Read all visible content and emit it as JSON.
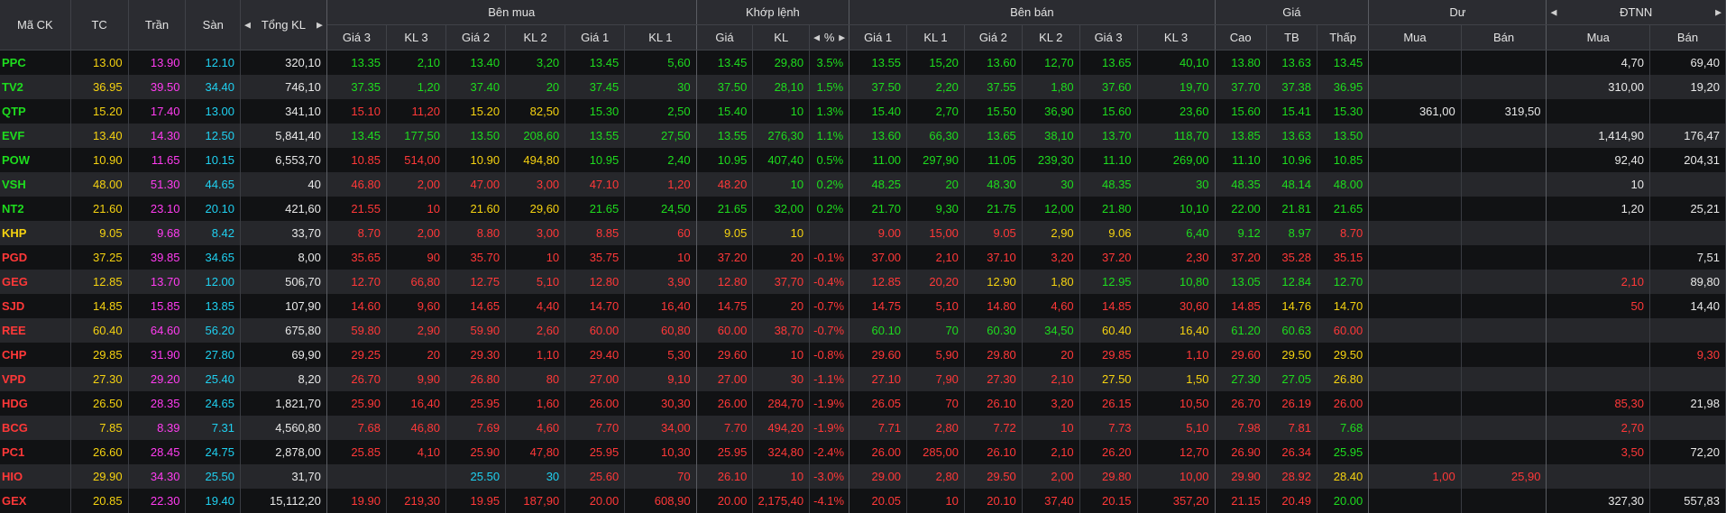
{
  "headers": {
    "top": {
      "symbol": "Mã CK",
      "ref": "TC",
      "ceil": "Trần",
      "floor": "Sàn",
      "total": "Tổng KL",
      "buy": "Bên mua",
      "match": "Khớp lệnh",
      "sell": "Bên bán",
      "price": "Giá",
      "remain": "Dư",
      "foreign": "ĐTNN"
    },
    "sub": {
      "buy": [
        "Giá 3",
        "KL 3",
        "Giá 2",
        "KL 2",
        "Giá 1",
        "KL 1"
      ],
      "match": [
        "Giá",
        "KL",
        "%"
      ],
      "sell": [
        "Giá 1",
        "KL 1",
        "Giá 2",
        "KL 2",
        "Giá 3",
        "KL 3"
      ],
      "price": [
        "Cao",
        "TB",
        "Thấp"
      ],
      "remain": [
        "Mua",
        "Bán"
      ],
      "foreign": [
        "Mua",
        "Bán"
      ]
    }
  },
  "colors": {
    "up": "#1edc1e",
    "down": "#ff3838",
    "ref": "#f5d210",
    "ceiling": "#ff3cf0",
    "floor": "#1fd0f0"
  },
  "rows": [
    {
      "s": "PPC",
      "t": "u",
      "c": [
        "13.00",
        "13.90",
        "12.10",
        "320,10",
        "13.35",
        "2,10",
        "13.40",
        "3,20",
        "13.45",
        "5,60",
        "13.45",
        "29,80",
        "3.5%",
        "13.55",
        "15,20",
        "13.60",
        "12,70",
        "13.65",
        "40,10",
        "13.80",
        "13.63",
        "13.45",
        "",
        "",
        "4,70",
        "69,40"
      ],
      "k": "ycfwuuuuuuuuuuuuuuuuuuwwww"
    },
    {
      "s": "TV2",
      "t": "u",
      "c": [
        "36.95",
        "39.50",
        "34.40",
        "746,10",
        "37.35",
        "1,20",
        "37.40",
        "20",
        "37.45",
        "30",
        "37.50",
        "28,10",
        "1.5%",
        "37.50",
        "2,20",
        "37.55",
        "1,80",
        "37.60",
        "19,70",
        "37.70",
        "37.38",
        "36.95",
        "",
        "",
        "310,00",
        "19,20"
      ],
      "k": "ycfwuuuuuuuuuuuuuuuuuuywwww"
    },
    {
      "s": "QTP",
      "t": "u",
      "c": [
        "15.20",
        "17.40",
        "13.00",
        "341,10",
        "15.10",
        "11,20",
        "15.20",
        "82,50",
        "15.30",
        "2,50",
        "15.40",
        "10",
        "1.3%",
        "15.40",
        "2,70",
        "15.50",
        "36,90",
        "15.60",
        "23,60",
        "15.60",
        "15.41",
        "15.30",
        "361,00",
        "319,50",
        "",
        ""
      ],
      "k": "ycfwddyyuuuuuuuuuuuuuuwwww"
    },
    {
      "s": "EVF",
      "t": "u",
      "c": [
        "13.40",
        "14.30",
        "12.50",
        "5,841,40",
        "13.45",
        "177,50",
        "13.50",
        "208,60",
        "13.55",
        "27,50",
        "13.55",
        "276,30",
        "1.1%",
        "13.60",
        "66,30",
        "13.65",
        "38,10",
        "13.70",
        "118,70",
        "13.85",
        "13.63",
        "13.50",
        "",
        "",
        "1,414,90",
        "176,47"
      ],
      "k": "ycfwuuuuuuuuuuuuuuuuuuuwwww"
    },
    {
      "s": "POW",
      "t": "u",
      "c": [
        "10.90",
        "11.65",
        "10.15",
        "6,553,70",
        "10.85",
        "514,00",
        "10.90",
        "494,80",
        "10.95",
        "2,40",
        "10.95",
        "407,40",
        "0.5%",
        "11.00",
        "297,90",
        "11.05",
        "239,30",
        "11.10",
        "269,00",
        "11.10",
        "10.96",
        "10.85",
        "",
        "",
        "92,40",
        "204,31"
      ],
      "k": "ycfwddyyuuuuuuuuuuuuuudwwww"
    },
    {
      "s": "VSH",
      "t": "u",
      "c": [
        "48.00",
        "51.30",
        "44.65",
        "40",
        "46.80",
        "2,00",
        "47.00",
        "3,00",
        "47.10",
        "1,20",
        "48.20",
        "10",
        "0.2%",
        "48.25",
        "20",
        "48.30",
        "30",
        "48.35",
        "30",
        "48.35",
        "48.14",
        "48.00",
        "",
        "",
        "10",
        ""
      ],
      "k": "ycfwddddddduuuuuuuuuuudywwww"
    },
    {
      "s": "NT2",
      "t": "u",
      "c": [
        "21.60",
        "23.10",
        "20.10",
        "421,60",
        "21.55",
        "10",
        "21.60",
        "29,60",
        "21.65",
        "24,50",
        "21.65",
        "32,00",
        "0.2%",
        "21.70",
        "9,30",
        "21.75",
        "12,00",
        "21.80",
        "10,10",
        "22.00",
        "21.81",
        "21.65",
        "",
        "",
        "1,20",
        "25,21"
      ],
      "k": "ycfwddyyuuuuuuuuuuuuuuuwwww"
    },
    {
      "s": "KHP",
      "t": "r",
      "c": [
        "9.05",
        "9.68",
        "8.42",
        "33,70",
        "8.70",
        "2,00",
        "8.80",
        "3,00",
        "8.85",
        "60",
        "9.05",
        "10",
        "",
        "9.00",
        "15,00",
        "9.05",
        "2,90",
        "9.06",
        "6,40",
        "9.12",
        "8.97",
        "8.70",
        "",
        "",
        "",
        ""
      ],
      "k": "ycfwddddddyyydddyyuuuddwwww"
    },
    {
      "s": "PGD",
      "t": "d",
      "c": [
        "37.25",
        "39.85",
        "34.65",
        "8,00",
        "35.65",
        "90",
        "35.70",
        "10",
        "35.75",
        "10",
        "37.20",
        "20",
        "-0.1%",
        "37.00",
        "2,10",
        "37.10",
        "3,20",
        "37.20",
        "2,30",
        "37.20",
        "35.28",
        "35.15",
        "",
        "",
        "",
        "7,51"
      ],
      "k": "ycfwdddddddddddddddddddwwww"
    },
    {
      "s": "GEG",
      "t": "d",
      "c": [
        "12.85",
        "13.70",
        "12.00",
        "506,70",
        "12.70",
        "66,80",
        "12.75",
        "5,10",
        "12.80",
        "3,90",
        "12.80",
        "37,70",
        "-0.4%",
        "12.85",
        "20,20",
        "12.90",
        "1,80",
        "12.95",
        "10,80",
        "13.05",
        "12.84",
        "12.70",
        "",
        "",
        "2,10",
        "89,80"
      ],
      "k": "ycfwdddddddddddyyuuuuuuudwwww"
    },
    {
      "s": "SJD",
      "t": "d",
      "c": [
        "14.85",
        "15.85",
        "13.85",
        "107,90",
        "14.60",
        "9,60",
        "14.65",
        "4,40",
        "14.70",
        "16,40",
        "14.75",
        "20",
        "-0.7%",
        "14.75",
        "5,10",
        "14.80",
        "4,60",
        "14.85",
        "30,60",
        "14.85",
        "14.76",
        "14.70",
        "",
        "",
        "50",
        "14,40"
      ],
      "k": "ycfwddddddddddddddddyyyddwwww"
    },
    {
      "s": "REE",
      "t": "d",
      "c": [
        "60.40",
        "64.60",
        "56.20",
        "675,80",
        "59.80",
        "2,90",
        "59.90",
        "2,60",
        "60.00",
        "60,80",
        "60.00",
        "38,70",
        "-0.7%",
        "60.10",
        "70",
        "60.30",
        "34,50",
        "60.40",
        "16,40",
        "61.20",
        "60.63",
        "60.00",
        "",
        "",
        "",
        ""
      ],
      "k": "ycfwddddddddduuuuyyuuddwwww"
    },
    {
      "s": "CHP",
      "t": "d",
      "c": [
        "29.85",
        "31.90",
        "27.80",
        "69,90",
        "29.25",
        "20",
        "29.30",
        "1,10",
        "29.40",
        "5,30",
        "29.60",
        "10",
        "-0.8%",
        "29.60",
        "5,90",
        "29.80",
        "20",
        "29.85",
        "1,10",
        "29.60",
        "29.50",
        "29.50",
        "",
        "",
        "",
        "9,30"
      ],
      "k": "ycfwddddddddddddddddyyddddwwww"
    },
    {
      "s": "VPD",
      "t": "d",
      "c": [
        "27.30",
        "29.20",
        "25.40",
        "8,20",
        "26.70",
        "9,90",
        "26.80",
        "80",
        "27.00",
        "9,10",
        "27.00",
        "30",
        "-1.1%",
        "27.10",
        "7,90",
        "27.30",
        "2,10",
        "27.50",
        "1,50",
        "27.30",
        "27.05",
        "26.80",
        "",
        "",
        "",
        ""
      ],
      "k": "ycfwdddddddddddddyyuuydddwwww"
    },
    {
      "s": "HDG",
      "t": "d",
      "c": [
        "26.50",
        "28.35",
        "24.65",
        "1,821,70",
        "25.90",
        "16,40",
        "25.95",
        "1,60",
        "26.00",
        "30,30",
        "26.00",
        "284,70",
        "-1.9%",
        "26.05",
        "70",
        "26.10",
        "3,20",
        "26.15",
        "10,50",
        "26.70",
        "26.19",
        "26.00",
        "",
        "",
        "85,30",
        "21,98"
      ],
      "k": "ycfwdddddddddddddddddduddwwww"
    },
    {
      "s": "BCG",
      "t": "d",
      "c": [
        "7.85",
        "8.39",
        "7.31",
        "4,560,80",
        "7.68",
        "46,80",
        "7.69",
        "4,60",
        "7.70",
        "34,00",
        "7.70",
        "494,20",
        "-1.9%",
        "7.71",
        "2,80",
        "7.72",
        "10",
        "7.73",
        "5,10",
        "7.98",
        "7.81",
        "7.68",
        "",
        "",
        "2,70",
        ""
      ],
      "k": "ycfwdddddddddddddddddudddwwww"
    },
    {
      "s": "PC1",
      "t": "d",
      "c": [
        "26.60",
        "28.45",
        "24.75",
        "2,878,00",
        "25.85",
        "4,10",
        "25.90",
        "47,80",
        "25.95",
        "10,30",
        "25.95",
        "324,80",
        "-2.4%",
        "26.00",
        "285,00",
        "26.10",
        "2,10",
        "26.20",
        "12,70",
        "26.90",
        "26.34",
        "25.95",
        "",
        "",
        "3,50",
        "72,20"
      ],
      "k": "ycfwdddddddddddddddddudddwwww"
    },
    {
      "s": "HIO",
      "t": "d",
      "c": [
        "29.90",
        "34.30",
        "25.50",
        "31,70",
        "",
        "",
        "25.50",
        "30",
        "25.60",
        "70",
        "26.10",
        "10",
        "-3.0%",
        "29.00",
        "2,80",
        "29.50",
        "2,00",
        "29.80",
        "10,00",
        "29.90",
        "28.92",
        "28.40",
        "1,00",
        "25,90",
        "",
        ""
      ],
      "k": "ycfwddffdddddddddddddyddwwww"
    },
    {
      "s": "GEX",
      "t": "d",
      "c": [
        "20.85",
        "22.30",
        "19.40",
        "15,112,20",
        "19.90",
        "219,30",
        "19.95",
        "187,90",
        "20.00",
        "608,90",
        "20.00",
        "2,175,40",
        "-4.1%",
        "20.05",
        "10",
        "20.10",
        "37,40",
        "20.15",
        "357,20",
        "21.15",
        "20.49",
        "20.00",
        "",
        "",
        "327,30",
        "557,83"
      ],
      "k": "ycfwddddddddddddddddduddwwww"
    }
  ]
}
